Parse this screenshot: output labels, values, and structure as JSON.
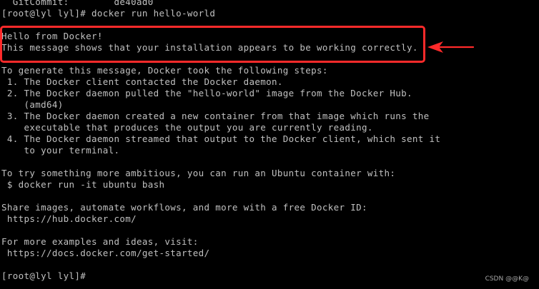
{
  "terminal": {
    "lines": [
      "  GitCommit:        de40ad0",
      "[root@lyl lyl]# docker run hello-world",
      "",
      "Hello from Docker!",
      "This message shows that your installation appears to be working correctly.",
      "",
      "To generate this message, Docker took the following steps:",
      " 1. The Docker client contacted the Docker daemon.",
      " 2. The Docker daemon pulled the \"hello-world\" image from the Docker Hub.",
      "    (amd64)",
      " 3. The Docker daemon created a new container from that image which runs the",
      "    executable that produces the output you are currently reading.",
      " 4. The Docker daemon streamed that output to the Docker client, which sent it",
      "    to your terminal.",
      "",
      "To try something more ambitious, you can run an Ubuntu container with:",
      " $ docker run -it ubuntu bash",
      "",
      "Share images, automate workflows, and more with a free Docker ID:",
      " https://hub.docker.com/",
      "",
      "For more examples and ideas, visit:",
      " https://docs.docker.com/get-started/",
      "",
      "[root@lyl lyl]#"
    ]
  },
  "annotation": {
    "box_color": "#ff2a2a",
    "arrow_color": "#ff2a2a",
    "arrow_icon": "left-arrow-icon"
  },
  "watermark": {
    "text": "CSDN @@K@"
  }
}
